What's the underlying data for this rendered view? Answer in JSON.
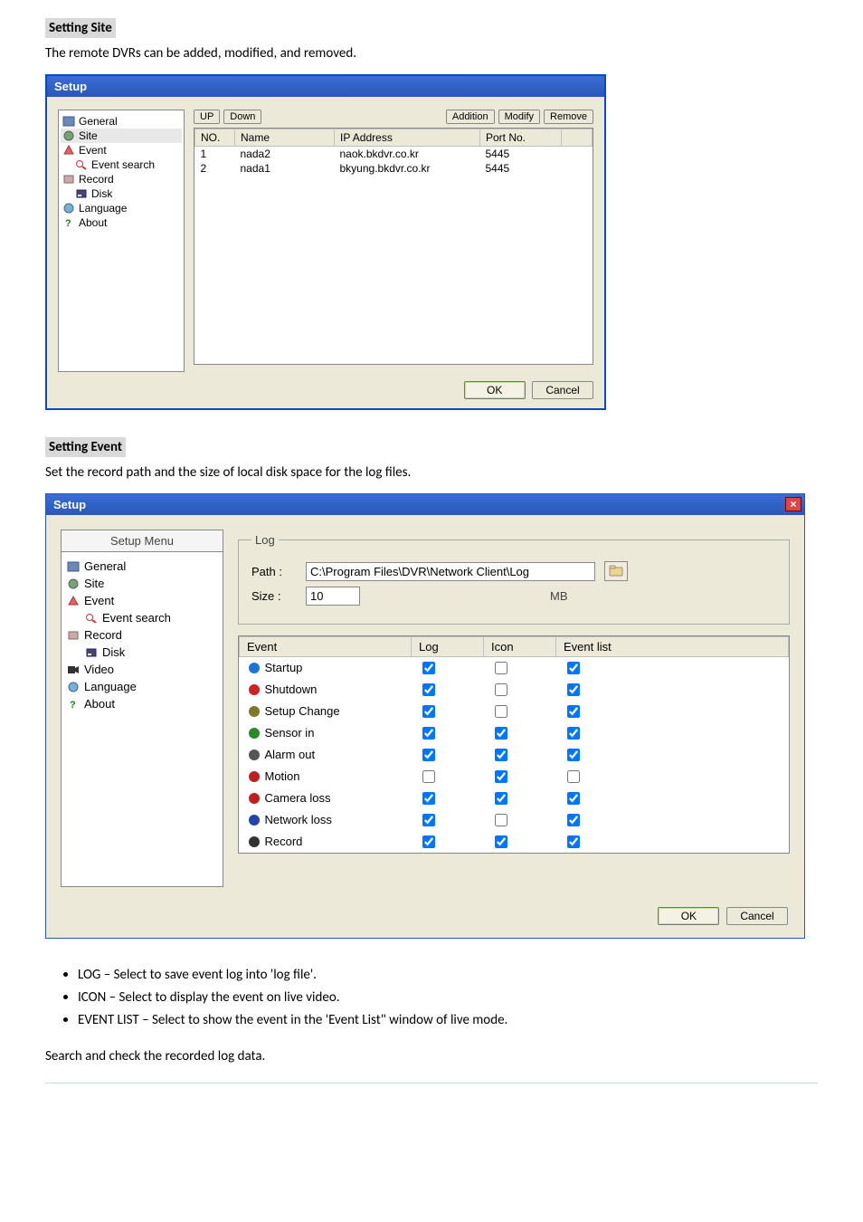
{
  "headings": {
    "setting_site": "Setting Site",
    "setting_event": "Setting Event"
  },
  "paragraphs": {
    "site": "The remote DVRs can be added, modified, and removed.",
    "event": "Set the record path and the size of local disk space for the log files.",
    "search": "Search and check the recorded log data."
  },
  "bullets": {
    "log": "LOG – Select to save event log into 'log file'.",
    "icon": "ICON – Select to display the event on live video.",
    "eventlist": "EVENT LIST – Select to show the event in the 'Event List\" window of live mode."
  },
  "dialog1": {
    "title": "Setup",
    "tree": {
      "general": "General",
      "site": "Site",
      "event": "Event",
      "event_search": "Event search",
      "record": "Record",
      "disk": "Disk",
      "language": "Language",
      "about": "About"
    },
    "buttons": {
      "up": "UP",
      "down": "Down",
      "addition": "Addition",
      "modify": "Modify",
      "remove": "Remove",
      "ok": "OK",
      "cancel": "Cancel"
    },
    "columns": {
      "no": "NO.",
      "name": "Name",
      "ip": "IP Address",
      "port": "Port No."
    },
    "rows": [
      {
        "no": "1",
        "name": "nada2",
        "ip": "naok.bkdvr.co.kr",
        "port": "5445"
      },
      {
        "no": "2",
        "name": "nada1",
        "ip": "bkyung.bkdvr.co.kr",
        "port": "5445"
      }
    ]
  },
  "dialog2": {
    "title": "Setup",
    "tree_header": "Setup Menu",
    "tree": {
      "general": "General",
      "site": "Site",
      "event": "Event",
      "event_search": "Event search",
      "record": "Record",
      "disk": "Disk",
      "video": "Video",
      "language": "Language",
      "about": "About"
    },
    "log_group": {
      "legend": "Log",
      "path_label": "Path :",
      "path_value": "C:\\Program Files\\DVR\\Network Client\\Log",
      "size_label": "Size :",
      "size_value": "10",
      "mb": "MB"
    },
    "ev_columns": {
      "event": "Event",
      "log": "Log",
      "icon": "Icon",
      "list": "Event list"
    },
    "events": [
      {
        "name": "Startup",
        "iconColor": "#1e73d8",
        "log": true,
        "icon": false,
        "list": true
      },
      {
        "name": "Shutdown",
        "iconColor": "#d02222",
        "log": true,
        "icon": false,
        "list": true
      },
      {
        "name": "Setup Change",
        "iconColor": "#7a7a28",
        "log": true,
        "icon": false,
        "list": true
      },
      {
        "name": "Sensor in",
        "iconColor": "#2a8a2a",
        "log": true,
        "icon": true,
        "list": true
      },
      {
        "name": "Alarm out",
        "iconColor": "#555555",
        "log": true,
        "icon": true,
        "list": true
      },
      {
        "name": "Motion",
        "iconColor": "#c01f1f",
        "log": false,
        "icon": true,
        "list": false
      },
      {
        "name": "Camera loss",
        "iconColor": "#c01f1f",
        "log": true,
        "icon": true,
        "list": true
      },
      {
        "name": "Network loss",
        "iconColor": "#2244aa",
        "log": true,
        "icon": false,
        "list": true
      },
      {
        "name": "Record",
        "iconColor": "#333333",
        "log": true,
        "icon": true,
        "list": true
      }
    ],
    "buttons": {
      "ok": "OK",
      "cancel": "Cancel"
    }
  }
}
